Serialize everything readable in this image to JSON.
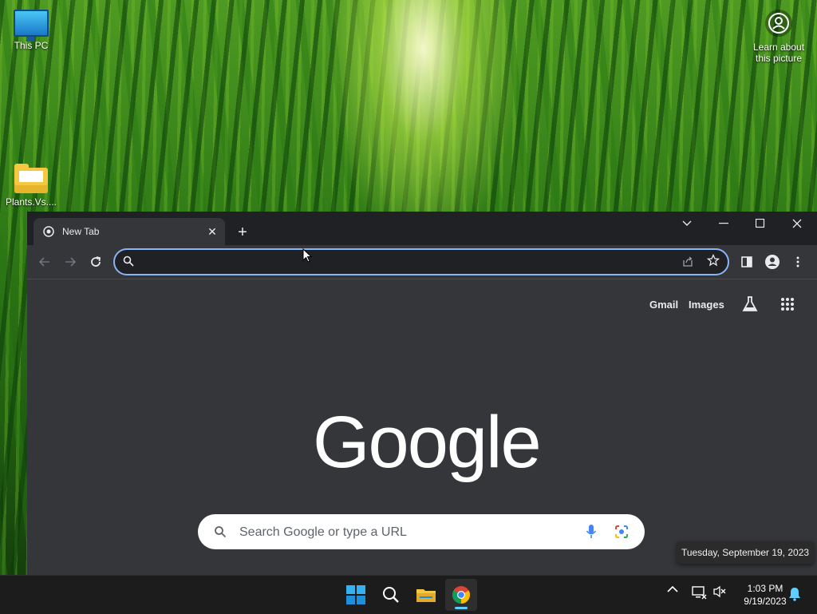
{
  "desktop": {
    "icons": [
      {
        "label": "This PC",
        "icon": "this-pc-icon"
      },
      {
        "label": "Plants.Vs....",
        "icon": "folder-icon"
      }
    ],
    "learn_about": {
      "line1": "Learn about",
      "line2": "this picture",
      "icon": "camera-circle-icon"
    }
  },
  "browser": {
    "tab_title": "New Tab",
    "omnibox": {
      "value": "",
      "placeholder": ""
    },
    "ntp": {
      "links": {
        "gmail": "Gmail",
        "images": "Images"
      },
      "logo_text": "Google",
      "search_placeholder": "Search Google or type a URL"
    },
    "colors": {
      "frame": "#202124",
      "toolbar": "#35363a",
      "focus": "#8ab4f8"
    }
  },
  "tooltip": {
    "date": "Tuesday, September 19, 2023"
  },
  "taskbar": {
    "apps": [
      "start-icon",
      "search-icon",
      "file-explorer-icon",
      "chrome-icon"
    ],
    "clock": {
      "time": "1:03 PM",
      "date": "9/19/2023"
    }
  }
}
